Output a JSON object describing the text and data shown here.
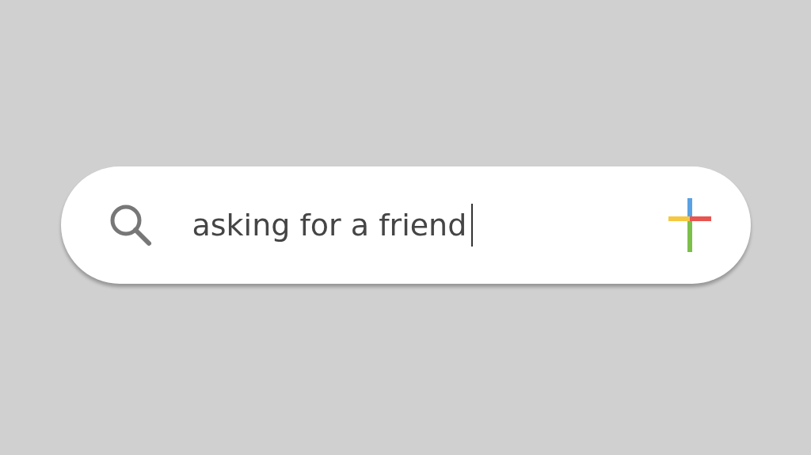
{
  "search": {
    "value": "asking for a friend",
    "focused": true
  }
}
